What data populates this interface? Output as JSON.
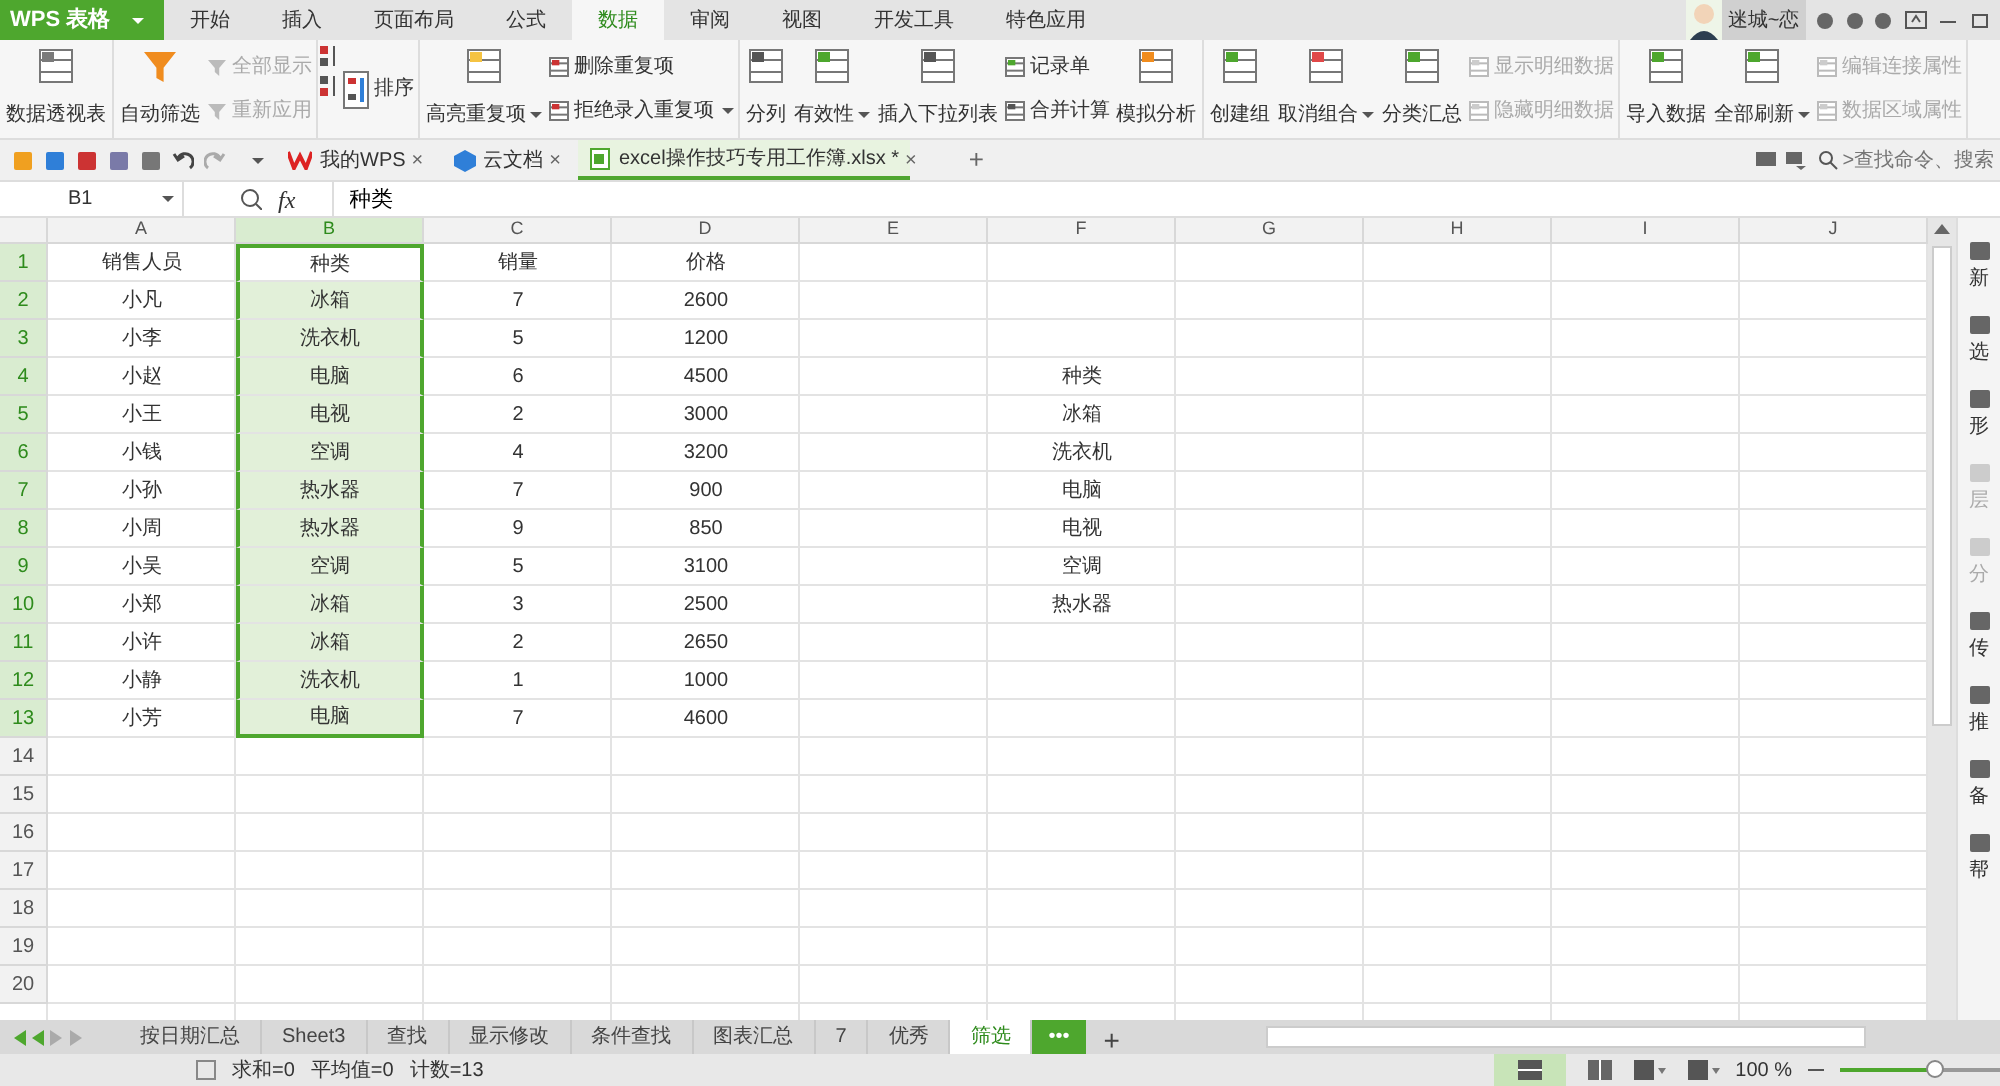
{
  "app": {
    "logo": "WPS 表格"
  },
  "menu_tabs": [
    {
      "label": "开始",
      "selected": false
    },
    {
      "label": "插入",
      "selected": false
    },
    {
      "label": "页面布局",
      "selected": false
    },
    {
      "label": "公式",
      "selected": false
    },
    {
      "label": "数据",
      "selected": true
    },
    {
      "label": "审阅",
      "selected": false
    },
    {
      "label": "视图",
      "selected": false
    },
    {
      "label": "开发工具",
      "selected": false
    },
    {
      "label": "特色应用",
      "selected": false
    }
  ],
  "user": {
    "name": "迷城~恋"
  },
  "ribbon": [
    {
      "items": [
        {
          "kind": "large",
          "label": "数据透视表",
          "disabled": false,
          "dropdown": false
        }
      ]
    },
    {
      "items": [
        {
          "kind": "large",
          "label": "自动筛选",
          "disabled": false,
          "dropdown": false
        },
        {
          "kind": "stack",
          "items": [
            {
              "label": "全部显示",
              "disabled": true,
              "dropdown": false
            },
            {
              "label": "重新应用",
              "disabled": true,
              "dropdown": false
            }
          ]
        }
      ]
    },
    {
      "items": [
        {
          "kind": "sort",
          "label": "排序",
          "disabled": false,
          "dropdown": false
        }
      ]
    },
    {
      "items": [
        {
          "kind": "large",
          "label": "高亮重复项",
          "disabled": false,
          "dropdown": true
        },
        {
          "kind": "stack",
          "items": [
            {
              "label": "删除重复项",
              "disabled": false,
              "dropdown": false
            },
            {
              "label": "拒绝录入重复项",
              "disabled": false,
              "dropdown": true
            }
          ]
        }
      ]
    },
    {
      "items": [
        {
          "kind": "large",
          "label": "分列",
          "disabled": false,
          "dropdown": false
        },
        {
          "kind": "large",
          "label": "有效性",
          "disabled": false,
          "dropdown": true
        },
        {
          "kind": "large",
          "label": "插入下拉列表",
          "disabled": false,
          "dropdown": false
        },
        {
          "kind": "stack",
          "items": [
            {
              "label": "记录单",
              "disabled": false,
              "dropdown": false
            },
            {
              "label": "合并计算",
              "disabled": false,
              "dropdown": false
            }
          ]
        },
        {
          "kind": "large",
          "label": "模拟分析",
          "disabled": false,
          "dropdown": false
        }
      ]
    },
    {
      "items": [
        {
          "kind": "large",
          "label": "创建组",
          "disabled": false,
          "dropdown": false
        },
        {
          "kind": "large",
          "label": "取消组合",
          "disabled": false,
          "dropdown": true
        },
        {
          "kind": "large",
          "label": "分类汇总",
          "disabled": false,
          "dropdown": false
        },
        {
          "kind": "stack",
          "items": [
            {
              "label": "显示明细数据",
              "disabled": true,
              "dropdown": false
            },
            {
              "label": "隐藏明细数据",
              "disabled": true,
              "dropdown": false
            }
          ]
        }
      ]
    },
    {
      "items": [
        {
          "kind": "large",
          "label": "导入数据",
          "disabled": false,
          "dropdown": false
        },
        {
          "kind": "large",
          "label": "全部刷新",
          "disabled": false,
          "dropdown": true
        },
        {
          "kind": "stack",
          "items": [
            {
              "label": "编辑连接属性",
              "disabled": true,
              "dropdown": false
            },
            {
              "label": "数据区域属性",
              "disabled": true,
              "dropdown": false
            }
          ]
        }
      ]
    }
  ],
  "doc_tabs": [
    {
      "label": "我的WPS",
      "selected": false,
      "close": "×"
    },
    {
      "label": "云文档",
      "selected": false,
      "close": "×"
    },
    {
      "label": "excel操作技巧专用工作簿.xlsx *",
      "selected": true,
      "close": "×"
    }
  ],
  "add_tab": "+",
  "command_search": {
    "placeholder": ">查找命令、搜索"
  },
  "formula_bar": {
    "name_box": "B1",
    "fx": "fx",
    "value": "种类"
  },
  "columns": [
    {
      "label": "A",
      "selected": false
    },
    {
      "label": "B",
      "selected": true
    },
    {
      "label": "C",
      "selected": false
    },
    {
      "label": "D",
      "selected": false
    },
    {
      "label": "E",
      "selected": false
    },
    {
      "label": "F",
      "selected": false
    },
    {
      "label": "G",
      "selected": false
    },
    {
      "label": "H",
      "selected": false
    },
    {
      "label": "I",
      "selected": false
    },
    {
      "label": "J",
      "selected": false
    }
  ],
  "rows": [
    {
      "number": "1",
      "selected": true,
      "cells": {
        "A": "销售人员",
        "B": "种类",
        "C": "销量",
        "D": "价格"
      }
    },
    {
      "number": "2",
      "selected": true,
      "cells": {
        "A": "小凡",
        "B": "冰箱",
        "C": "7",
        "D": "2600"
      }
    },
    {
      "number": "3",
      "selected": true,
      "cells": {
        "A": "小李",
        "B": "洗衣机",
        "C": "5",
        "D": "1200"
      }
    },
    {
      "number": "4",
      "selected": true,
      "cells": {
        "A": "小赵",
        "B": "电脑",
        "C": "6",
        "D": "4500",
        "F": "种类"
      }
    },
    {
      "number": "5",
      "selected": true,
      "cells": {
        "A": "小王",
        "B": "电视",
        "C": "2",
        "D": "3000",
        "F": "冰箱"
      }
    },
    {
      "number": "6",
      "selected": true,
      "cells": {
        "A": "小钱",
        "B": "空调",
        "C": "4",
        "D": "3200",
        "F": "洗衣机"
      }
    },
    {
      "number": "7",
      "selected": true,
      "cells": {
        "A": "小孙",
        "B": "热水器",
        "C": "7",
        "D": "900",
        "F": "电脑"
      }
    },
    {
      "number": "8",
      "selected": true,
      "cells": {
        "A": "小周",
        "B": "热水器",
        "C": "9",
        "D": "850",
        "F": "电视"
      }
    },
    {
      "number": "9",
      "selected": true,
      "cells": {
        "A": "小吴",
        "B": "空调",
        "C": "5",
        "D": "3100",
        "F": "空调"
      }
    },
    {
      "number": "10",
      "selected": true,
      "cells": {
        "A": "小郑",
        "B": "冰箱",
        "C": "3",
        "D": "2500",
        "F": "热水器"
      }
    },
    {
      "number": "11",
      "selected": true,
      "cells": {
        "A": "小许",
        "B": "冰箱",
        "C": "2",
        "D": "2650"
      }
    },
    {
      "number": "12",
      "selected": true,
      "cells": {
        "A": "小静",
        "B": "洗衣机",
        "C": "1",
        "D": "1000"
      }
    },
    {
      "number": "13",
      "selected": true,
      "cells": {
        "A": "小芳",
        "B": "电脑",
        "C": "7",
        "D": "4600"
      }
    },
    {
      "number": "14",
      "selected": false,
      "cells": {}
    },
    {
      "number": "15",
      "selected": false,
      "cells": {}
    },
    {
      "number": "16",
      "selected": false,
      "cells": {}
    },
    {
      "number": "17",
      "selected": false,
      "cells": {}
    },
    {
      "number": "18",
      "selected": false,
      "cells": {}
    },
    {
      "number": "19",
      "selected": false,
      "cells": {}
    },
    {
      "number": "20",
      "selected": false,
      "cells": {}
    }
  ],
  "side_panel": [
    {
      "label": "新",
      "disabled": false
    },
    {
      "label": "选",
      "disabled": false
    },
    {
      "label": "形",
      "disabled": false
    },
    {
      "label": "层",
      "disabled": true
    },
    {
      "label": "分",
      "disabled": true
    },
    {
      "label": "传",
      "disabled": false
    },
    {
      "label": "推",
      "disabled": false
    },
    {
      "label": "备",
      "disabled": false
    },
    {
      "label": "帮",
      "disabled": false
    }
  ],
  "sheet_tabs": [
    {
      "label": "按日期汇总",
      "selected": false
    },
    {
      "label": "Sheet3",
      "selected": false
    },
    {
      "label": "查找",
      "selected": false
    },
    {
      "label": "显示修改",
      "selected": false
    },
    {
      "label": "条件查找",
      "selected": false
    },
    {
      "label": "图表汇总",
      "selected": false
    },
    {
      "label": "7",
      "selected": false
    },
    {
      "label": "优秀",
      "selected": false
    },
    {
      "label": "筛选",
      "selected": true
    }
  ],
  "more_sheets": "•••",
  "add_sheet": "+",
  "status_bar": {
    "items": [
      "求和=0",
      "平均值=0",
      "计数=13"
    ],
    "zoom": "100 %",
    "zoom_level": {
      "level": 0.6
    }
  }
}
